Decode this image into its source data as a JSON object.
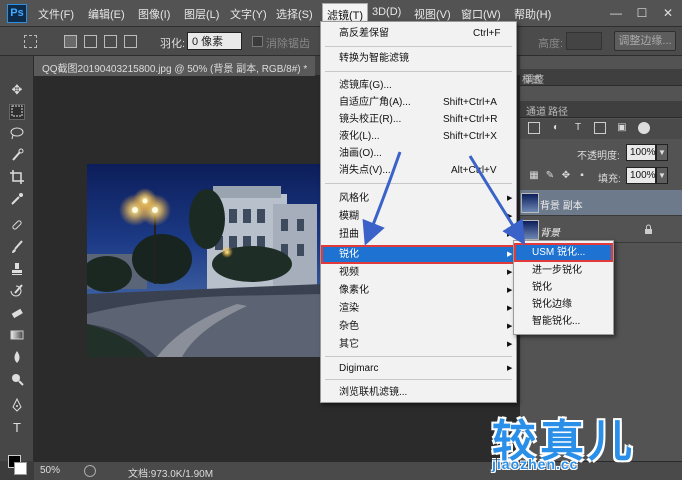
{
  "app_logo": "Ps",
  "menubar": {
    "items": [
      "文件(F)",
      "编辑(E)",
      "图像(I)",
      "图层(L)",
      "文字(Y)",
      "选择(S)",
      "滤镜(T)",
      "3D(D)",
      "视图(V)",
      "窗口(W)",
      "帮助(H)"
    ],
    "active_index": 6
  },
  "window_controls": [
    "—",
    "☐",
    "✕"
  ],
  "options_bar": {
    "feather_label": "羽化:",
    "feather_value": "0 像素",
    "antialias_label": "消除锯齿",
    "height_label": "高度:",
    "refine_edge": "调整边缘..."
  },
  "document_tab": "QQ截图20190403215800.jpg @ 50% (背景 副本, RGB/8#) *",
  "status_bar": {
    "zoom": "50%",
    "doc_size": "文档:973.0K/1.90M"
  },
  "panels": {
    "tab_row1": [
      "调整",
      "样式"
    ],
    "tab_row2": [
      "通道",
      "路径"
    ],
    "opacity_label": "不透明度:",
    "opacity_value": "100%",
    "fill_label": "填充:",
    "fill_value": "100%",
    "layers": [
      {
        "name": "背景 副本",
        "selected": true
      },
      {
        "name": "背景",
        "selected": false
      }
    ]
  },
  "filter_menu": {
    "items": [
      {
        "label": "高反差保留",
        "shortcut": "Ctrl+F"
      },
      {
        "label": "转换为智能滤镜"
      },
      {
        "label": "滤镜库(G)..."
      },
      {
        "label": "自适应广角(A)...",
        "shortcut": "Shift+Ctrl+A"
      },
      {
        "label": "镜头校正(R)...",
        "shortcut": "Shift+Ctrl+R"
      },
      {
        "label": "液化(L)...",
        "shortcut": "Shift+Ctrl+X"
      },
      {
        "label": "油画(O)..."
      },
      {
        "label": "消失点(V)...",
        "shortcut": "Alt+Ctrl+V"
      },
      {
        "label": "风格化",
        "submenu": true
      },
      {
        "label": "模糊",
        "submenu": true
      },
      {
        "label": "扭曲",
        "submenu": true
      },
      {
        "label": "锐化",
        "submenu": true,
        "highlighted": true
      },
      {
        "label": "视频",
        "submenu": true
      },
      {
        "label": "像素化",
        "submenu": true
      },
      {
        "label": "渲染",
        "submenu": true
      },
      {
        "label": "杂色",
        "submenu": true
      },
      {
        "label": "其它",
        "submenu": true
      },
      {
        "label": "Digimarc",
        "submenu": true
      },
      {
        "label": "浏览联机滤镜..."
      }
    ]
  },
  "sharpen_submenu": {
    "items": [
      "USM 锐化...",
      "进一步锐化",
      "锐化",
      "锐化边缘",
      "智能锐化..."
    ],
    "highlighted_index": 0
  },
  "icons": {
    "submenu_arrow": "▶",
    "dropdown": "▼",
    "lock": "🔒"
  },
  "watermark": {
    "text": "较真儿",
    "url": "jiaozhen.cc"
  },
  "colors": {
    "highlight": "#1e73d2",
    "annotation": "#e23a3a",
    "watermark": "#2a8fe8"
  }
}
